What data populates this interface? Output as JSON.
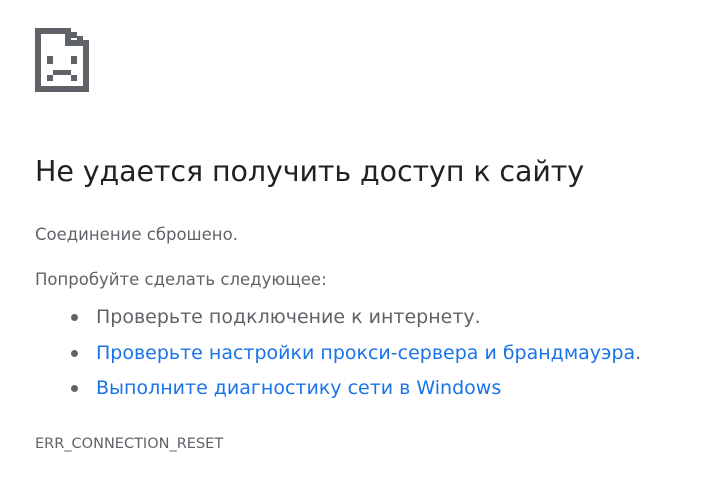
{
  "icon": {
    "name": "sad-page-icon",
    "color": "#5f6368"
  },
  "main": {
    "title": "Не удается получить доступ к сайту",
    "summary": "Соединение сброшено.",
    "suggestions_heading": "Попробуйте сделать следующее:",
    "suggestions": [
      {
        "text": "Проверьте подключение к интернету.",
        "link": false
      },
      {
        "text": "Проверьте настройки прокси-сервера и брандмауэра",
        "suffix": ".",
        "link": true
      },
      {
        "text": "Выполните диагностику сети в Windows",
        "link": true
      }
    ],
    "error_code": "ERR_CONNECTION_RESET"
  },
  "colors": {
    "title": "#202124",
    "text": "#5f6368",
    "link": "#1a73e8",
    "background": "#ffffff"
  }
}
